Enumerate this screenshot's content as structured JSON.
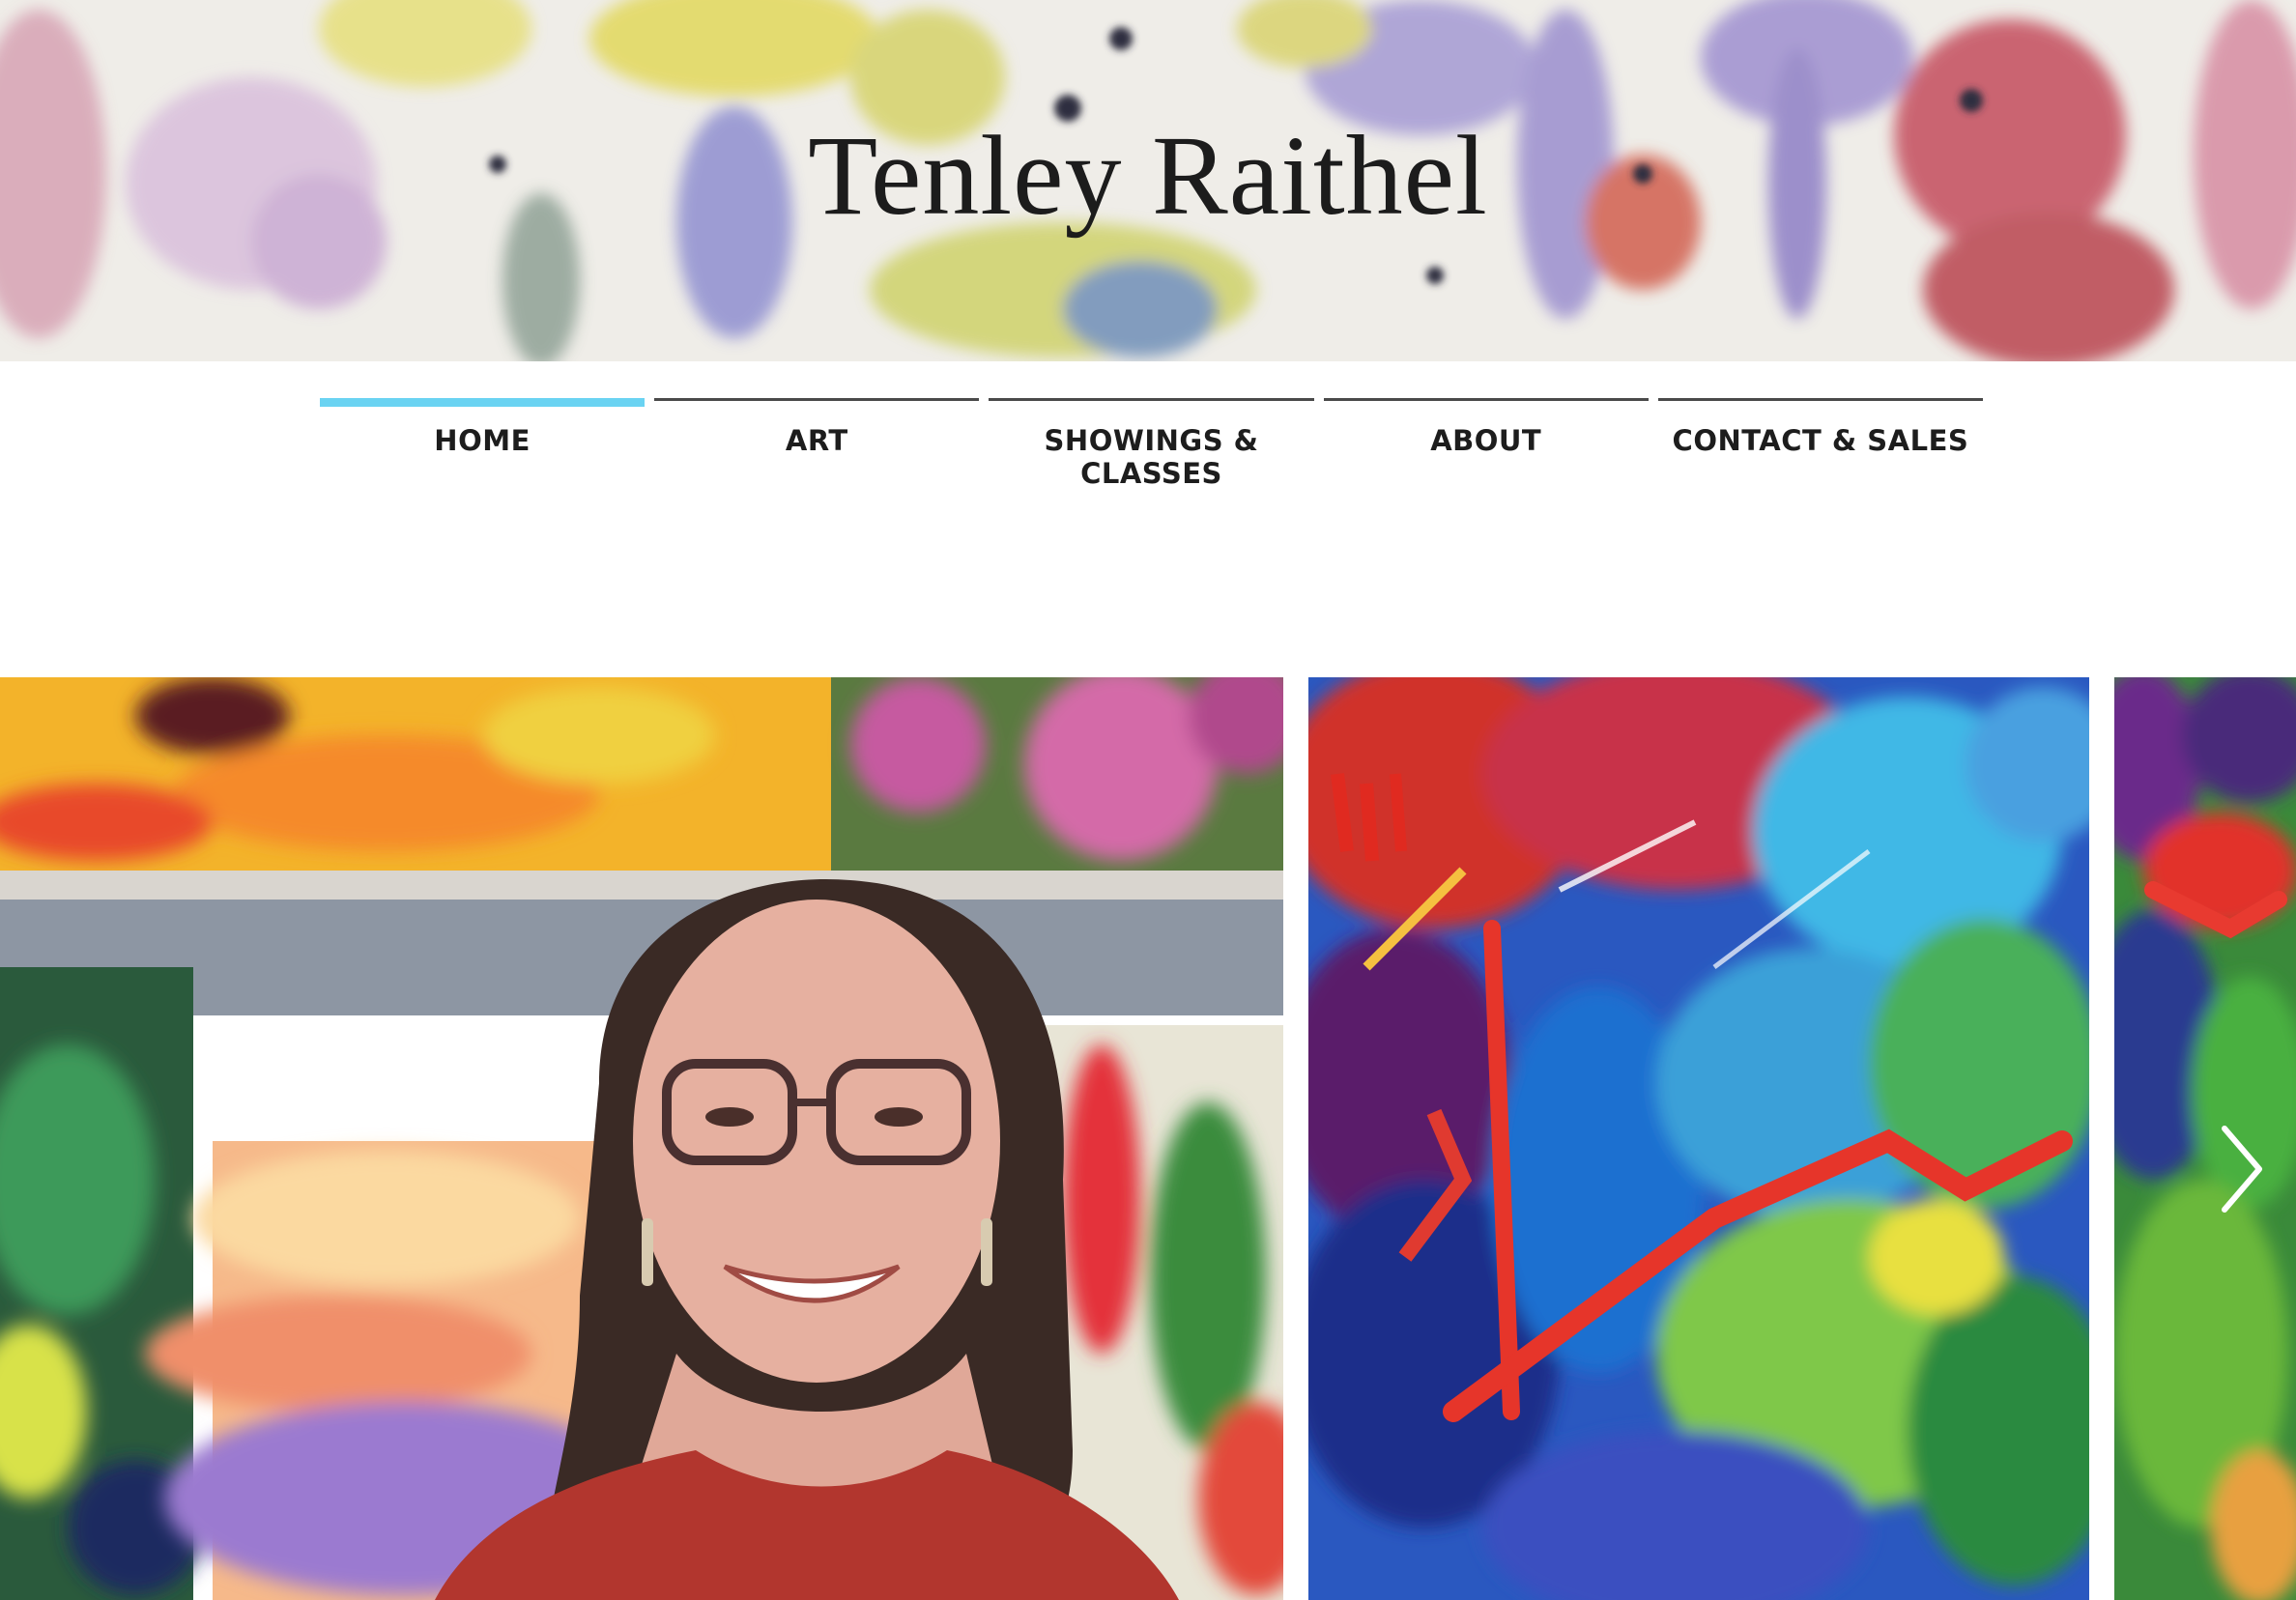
{
  "site": {
    "title": "Tenley Raithel"
  },
  "nav": {
    "items": [
      {
        "label": "HOME",
        "active": true
      },
      {
        "label": "ART",
        "active": false
      },
      {
        "label": "SHOWINGS & CLASSES",
        "active": false
      },
      {
        "label": "ABOUT",
        "active": false
      },
      {
        "label": "CONTACT & SALES",
        "active": false
      }
    ]
  },
  "colors": {
    "active_indicator": "#6ad3f2",
    "nav_line": "#4a4a4a",
    "text": "#1d1d1d"
  },
  "gallery": {
    "slides": [
      {
        "name": "artist-portrait"
      },
      {
        "name": "abstract-painting-1"
      },
      {
        "name": "abstract-painting-2"
      }
    ],
    "next_icon": "chevron-right-icon"
  }
}
